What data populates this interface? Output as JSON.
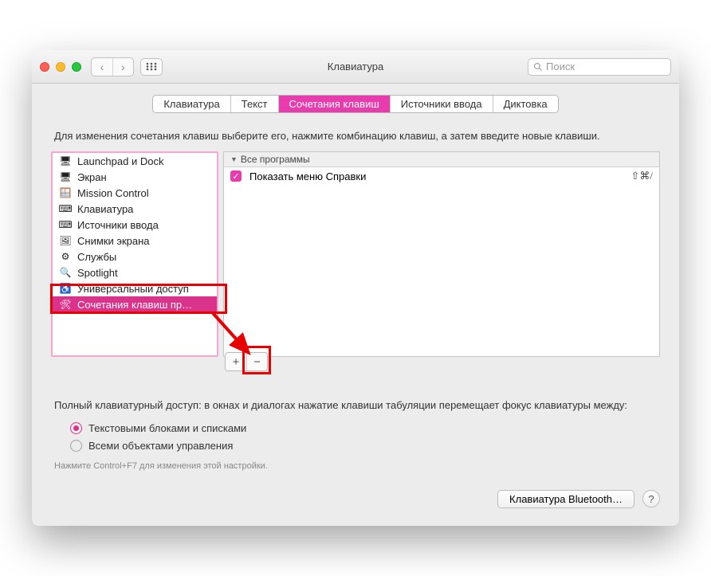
{
  "window": {
    "title": "Клавиатура"
  },
  "search": {
    "placeholder": "Поиск"
  },
  "tabs": [
    {
      "label": "Клавиатура"
    },
    {
      "label": "Текст"
    },
    {
      "label": "Сочетания клавиш",
      "active": true
    },
    {
      "label": "Источники ввода"
    },
    {
      "label": "Диктовка"
    }
  ],
  "instructions": "Для изменения сочетания клавиш выберите его, нажмите комбинацию клавиш, а затем введите новые клавиши.",
  "categories": [
    {
      "icon": "🖥",
      "icon_name": "launchpad-icon",
      "label": "Launchpad и Dock"
    },
    {
      "icon": "🖥",
      "icon_name": "display-icon",
      "label": "Экран"
    },
    {
      "icon": "🪟",
      "icon_name": "mission-control-icon",
      "label": "Mission Control"
    },
    {
      "icon": "⌨",
      "icon_name": "keyboard-icon",
      "label": "Клавиатура"
    },
    {
      "icon": "⌨",
      "icon_name": "input-sources-icon",
      "label": "Источники ввода"
    },
    {
      "icon": "🖼",
      "icon_name": "screenshots-icon",
      "label": "Снимки экрана"
    },
    {
      "icon": "⚙",
      "icon_name": "services-icon",
      "label": "Службы"
    },
    {
      "icon": "🔍",
      "icon_name": "spotlight-icon",
      "label": "Spotlight"
    },
    {
      "icon": "♿",
      "icon_name": "accessibility-icon",
      "label": "Универсальный доступ"
    },
    {
      "icon": "🛠",
      "icon_name": "app-shortcuts-icon",
      "label": "Сочетания клавиш пр…",
      "selected": true
    }
  ],
  "right_panel": {
    "header": "Все программы",
    "items": [
      {
        "checked": true,
        "label": "Показать меню Справки",
        "shortcut": "⇧⌘/"
      }
    ]
  },
  "add_label": "+",
  "remove_label": "−",
  "full_access": {
    "text": "Полный клавиатурный доступ: в окнах и диалогах нажатие клавиши табуляции перемещает фокус клавиатуры между:",
    "options": [
      {
        "label": "Текстовыми блоками и списками",
        "selected": true
      },
      {
        "label": "Всеми объектами управления",
        "selected": false
      }
    ],
    "hint": "Нажмите Control+F7 для изменения этой настройки."
  },
  "footer": {
    "bluetooth": "Клавиатура Bluetooth…",
    "help": "?"
  }
}
